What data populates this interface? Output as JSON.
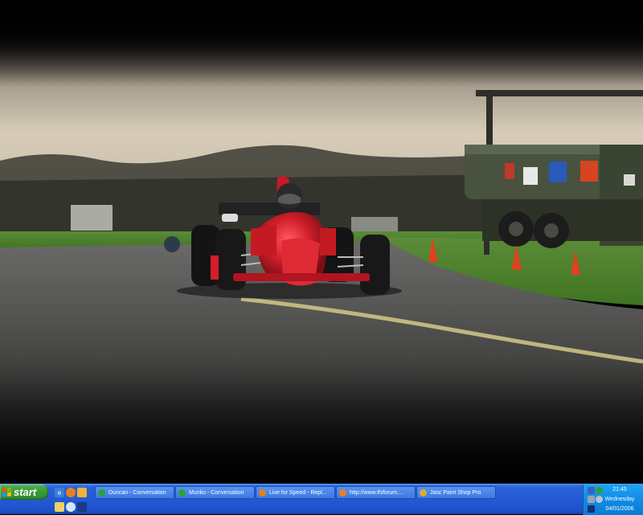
{
  "wallpaper": {
    "description_icon": "racing-car-photo",
    "colors": {
      "sky": "#cfc6b4",
      "tarmac": "#4f4f4f",
      "grass": "#4d8a2e",
      "car": "#d31f2b",
      "truck": "#3f4a36",
      "cone": "#e0421f"
    }
  },
  "taskbar": {
    "start_label": "start",
    "quick_launch": [
      "internet-explorer-icon",
      "firefox-icon",
      "media-icon",
      "folder-icon",
      "clock-icon",
      "messenger-icon"
    ],
    "tasks": [
      {
        "label": "Duncan - Conversation",
        "icon": "messenger-icon",
        "color": "#2aa236"
      },
      {
        "label": "Munko - Conversation",
        "icon": "messenger-icon",
        "color": "#2aa236"
      },
      {
        "label": "Live for Speed - Repl...",
        "icon": "firefox-icon",
        "color": "#e8811c"
      },
      {
        "label": "http://www.lfsforum....",
        "icon": "firefox-icon",
        "color": "#e8811c"
      },
      {
        "label": "Jasc Paint Shop Pro",
        "icon": "paint-shop-pro-icon",
        "color": "#d9b034"
      }
    ],
    "tray": {
      "time": "21:45",
      "day": "Wednesday",
      "date": "04/01/2006"
    }
  }
}
